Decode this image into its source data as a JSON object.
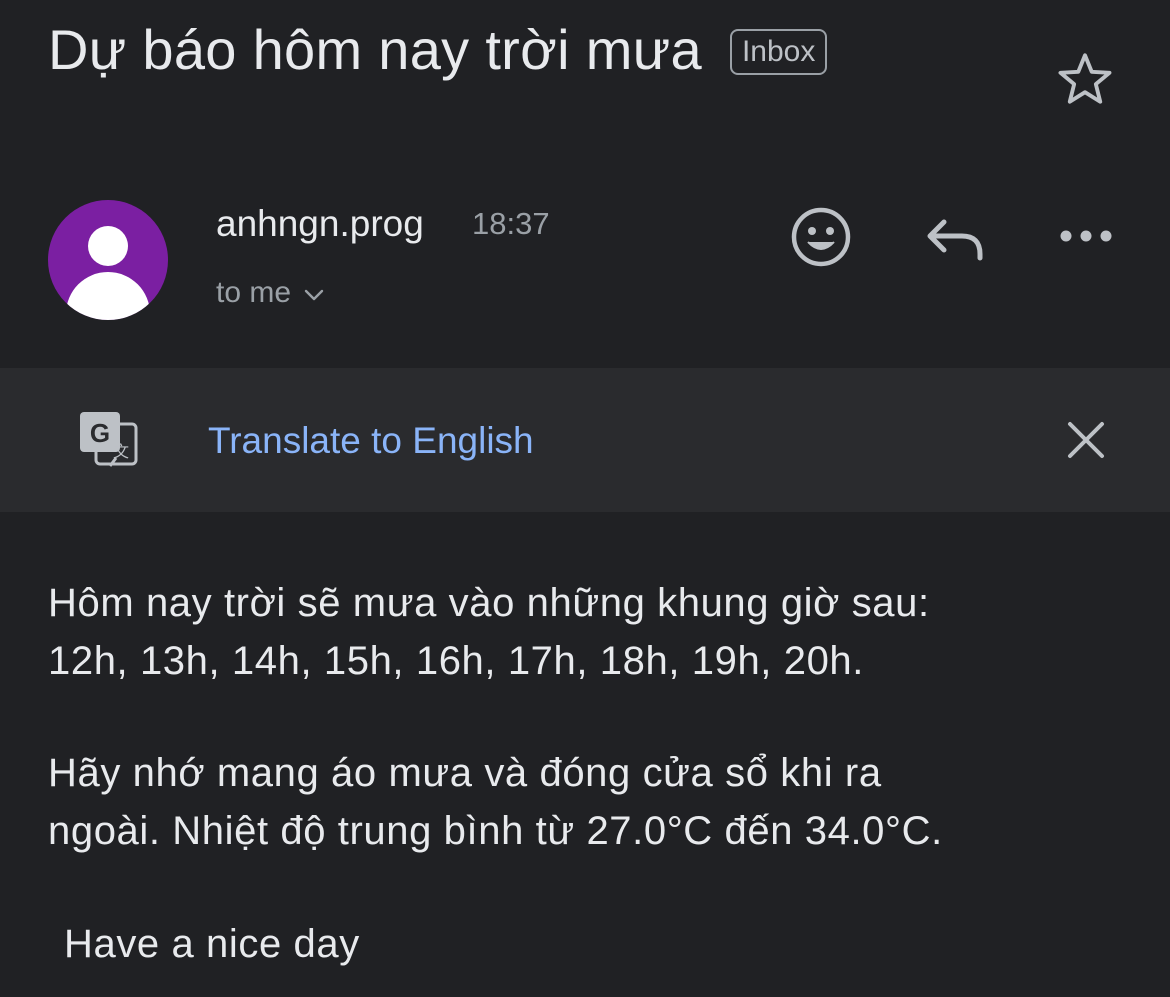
{
  "email": {
    "subject": "Dự báo hôm nay trời mưa",
    "label": "Inbox",
    "sender": "anhngn.prog",
    "time": "18:37",
    "recipient": "to me"
  },
  "translate_bar": {
    "link_text": "Translate to English"
  },
  "body": {
    "paragraph1": [
      "Hôm nay trời sẽ mưa vào những khung giờ sau:",
      "12h, 13h, 14h, 15h, 16h, 17h, 18h, 19h, 20h."
    ],
    "paragraph2": [
      "Hãy nhớ mang áo mưa và đóng cửa sổ khi ra",
      "ngoài. Nhiệt độ trung bình từ 27.0°C đến 34.0°C."
    ],
    "closing": "Have a nice day"
  },
  "colors": {
    "background": "#202124",
    "avatar": "#7b1fa2",
    "link": "#8ab4f8",
    "translate_bar": "#2a2b2e"
  },
  "icons": {
    "star": "star-icon",
    "emoji": "emoji-icon",
    "reply": "reply-icon",
    "more": "more-icon",
    "translate": "translate-icon",
    "close": "close-icon",
    "chevron": "chevron-down-icon"
  }
}
